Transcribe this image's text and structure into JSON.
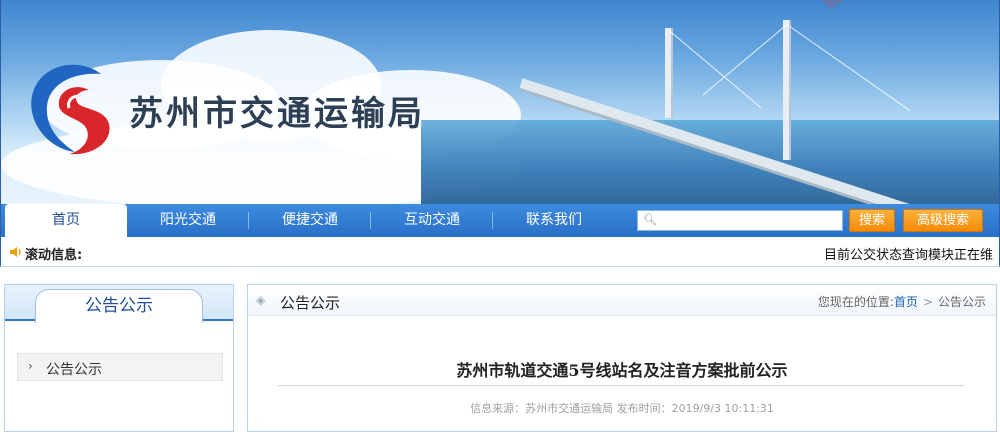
{
  "header": {
    "site_title": "苏州市交通运输局",
    "logo_icon": "suzhou-transport-logo-icon",
    "colors": {
      "nav_blue": "#2a6fc8",
      "logo_blue": "#1f65c1",
      "logo_red": "#d8262a",
      "button_orange": "#f28a0a"
    }
  },
  "nav": {
    "items": [
      {
        "label": "首页",
        "active": true
      },
      {
        "label": "阳光交通"
      },
      {
        "label": "便捷交通"
      },
      {
        "label": "互动交通"
      },
      {
        "label": "联系我们"
      }
    ],
    "search": {
      "placeholder": "",
      "value": "",
      "icon": "search-icon"
    },
    "search_label": "搜索",
    "advanced_search_label": "高级搜索"
  },
  "ticker": {
    "icon": "speaker-icon",
    "label": "滚动信息:",
    "text": "目前公交状态查询模块正在维"
  },
  "sidebar": {
    "title": "公告公示",
    "items": [
      {
        "label": "公告公示"
      }
    ]
  },
  "main": {
    "section_title": "公告公示",
    "breadcrumb": {
      "prefix": "您现在的位置:",
      "home": "首页",
      "separator": ">",
      "current": "公告公示"
    },
    "article": {
      "title": "苏州市轨道交通5号线站名及注音方案批前公示",
      "meta": "信息来源：苏州市交通运输局 发布时间：2019/9/3 10:11:31"
    }
  }
}
